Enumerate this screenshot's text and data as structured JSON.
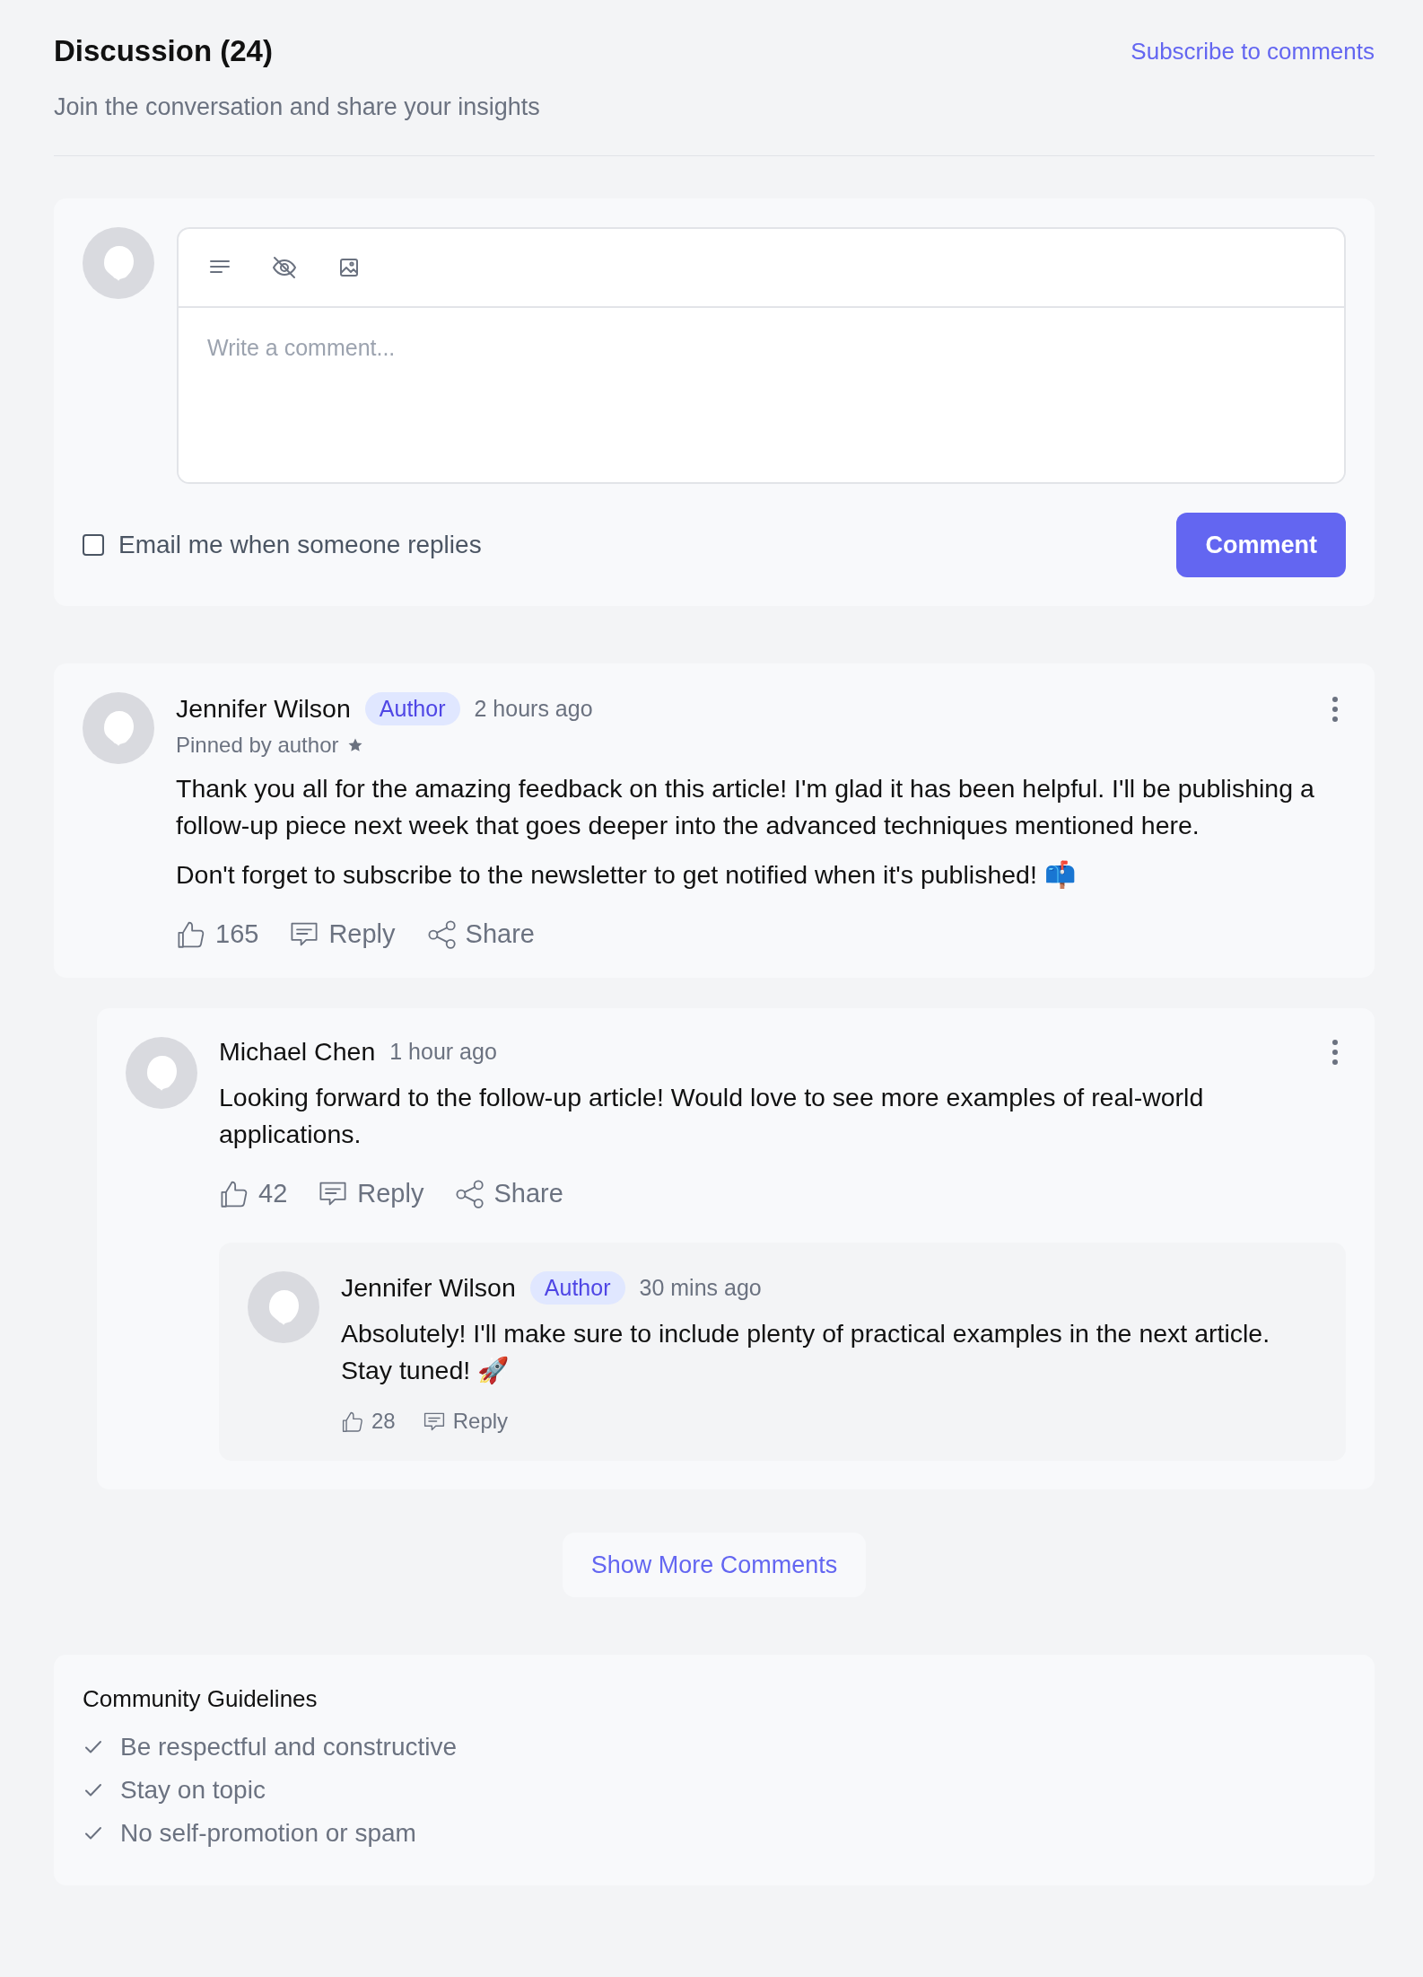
{
  "header": {
    "title": "Discussion (24)",
    "subscribe_link": "Subscribe to comments",
    "subtitle": "Join the conversation and share your insights"
  },
  "composer": {
    "placeholder": "Write a comment...",
    "email_option": {
      "label": "Email me when someone replies",
      "checked": false
    },
    "submit": "Comment"
  },
  "comments": [
    {
      "author": "Jennifer Wilson",
      "badge": "Author",
      "time": "2 hours ago",
      "pinned": "Pinned by author",
      "menu": true,
      "paragraphs": [
        "Thank you all for the amazing feedback on this article! I'm glad it has been helpful. I'll be publishing a follow-up piece next week that goes deeper into the advanced techniques mentioned here.",
        "Don't forget to subscribe to the newsletter to get notified when it's published! 📫"
      ],
      "likes": "165",
      "reply": "Reply",
      "share": "Share",
      "replies": [
        {
          "author": "Michael Chen",
          "time": "1 hour ago",
          "menu": true,
          "paragraphs": [
            "Looking forward to the follow-up article! Would love to see more examples of real-world applications."
          ],
          "likes": "42",
          "reply": "Reply",
          "share": "Share",
          "replies": [
            {
              "author": "Jennifer Wilson",
              "badge": "Author",
              "time": "30 mins ago",
              "paragraphs": [
                "Absolutely! I'll make sure to include plenty of practical examples in the next article. Stay tuned! 🚀"
              ],
              "likes": "28",
              "reply": "Reply"
            }
          ]
        }
      ]
    }
  ],
  "show_more": "Show More Comments",
  "guidelines": {
    "title": "Community Guidelines",
    "items": [
      "Be respectful and constructive",
      "Stay on topic",
      "No self-promotion or spam"
    ]
  }
}
